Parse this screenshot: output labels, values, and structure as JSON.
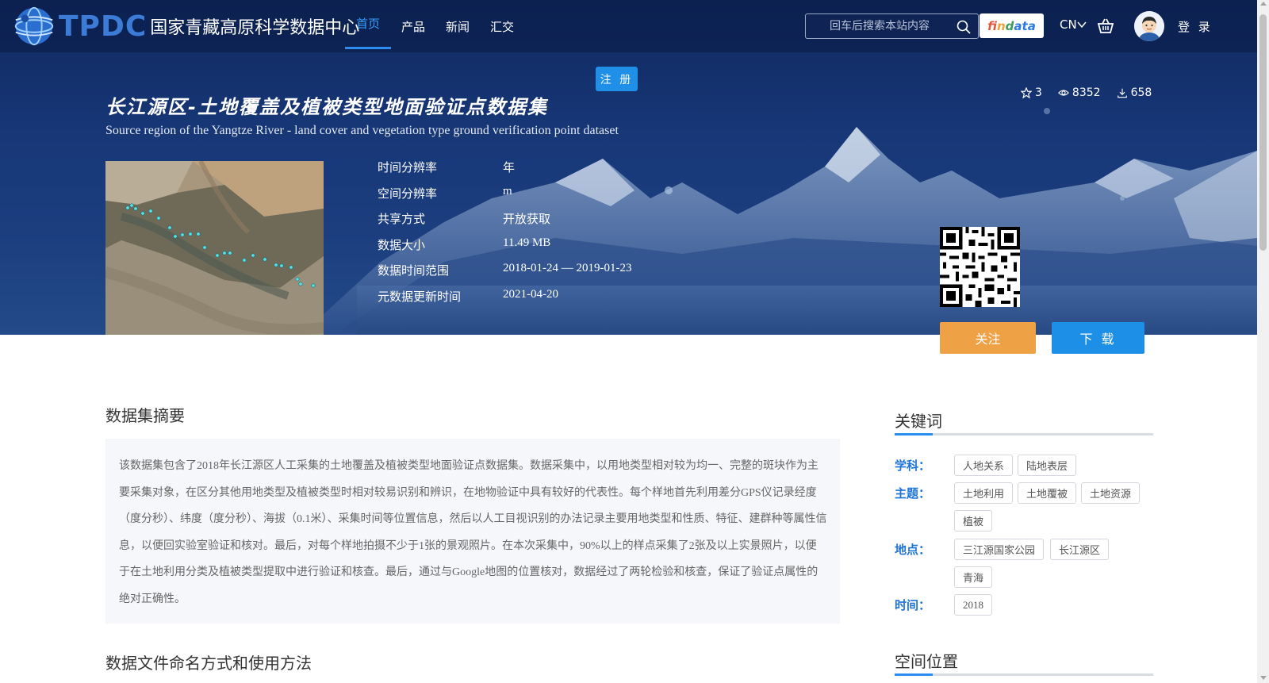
{
  "header": {
    "logo_text": "TPDC",
    "site_name": "国家青藏高原科学数据中心",
    "nav": [
      {
        "label": "首页",
        "active": true
      },
      {
        "label": "产品",
        "active": false
      },
      {
        "label": "新闻",
        "active": false
      },
      {
        "label": "汇交",
        "active": false
      }
    ],
    "search_placeholder": "回车后搜索本站内容",
    "findata": {
      "p1": "fi",
      "p2": "n",
      "p3": "d",
      "p4": "ata"
    },
    "lang": "CN",
    "login": "登 录",
    "icons": [
      "search-icon",
      "cart-icon",
      "avatar",
      "chevron-down-icon"
    ]
  },
  "dataset": {
    "register_label": "注 册",
    "title_cn": "长江源区-土地覆盖及植被类型地面验证点数据集",
    "title_en": "Source region of the Yangtze River - land cover and vegetation type ground verification point dataset",
    "stats": {
      "stars": "3",
      "views": "8352",
      "downloads": "658"
    },
    "meta": [
      {
        "key": "时间分辨率",
        "value": "年"
      },
      {
        "key": "空间分辨率",
        "value": "m"
      },
      {
        "key": "共享方式",
        "value": "开放获取"
      },
      {
        "key": "数据大小",
        "value": "11.49 MB"
      },
      {
        "key": "数据时间范围",
        "value": "2018-01-24 — 2019-01-23"
      },
      {
        "key": "元数据更新时间",
        "value": "2021-04-20"
      }
    ],
    "follow_label": "关注",
    "download_label": "下 载"
  },
  "abstract": {
    "heading": "数据集摘要",
    "text": "该数据集包含了2018年长江源区人工采集的土地覆盖及植被类型地面验证点数据集。数据采集中，以用地类型相对较为均一、完整的斑块作为主要采集对象，在区分其他用地类型及植被类型时相对较易识别和辨识，在地物验证中具有较好的代表性。每个样地首先利用差分GPS仪记录经度（度分秒）、纬度（度分秒）、海拔（0.1米）、采集时间等位置信息，然后以人工目视识别的办法记录主要用地类型和性质、特征、建群种等属性信息，以便回实验室验证和核对。最后，对每个样地拍摄不少于1张的景观照片。在本次采集中，90%以上的样点采集了2张及以上实景照片，以便于在土地利用分类及植被类型提取中进行验证和核查。最后，通过与Google地图的位置核对，数据经过了两轮检验和核查，保证了验证点属性的绝对正确性。"
  },
  "filename_heading": "数据文件命名方式和使用方法",
  "keywords": {
    "heading": "关键词",
    "groups": [
      {
        "label": "学科：",
        "tags": [
          "人地关系",
          "陆地表层"
        ]
      },
      {
        "label": "主题：",
        "tags": [
          "土地利用",
          "土地覆被",
          "土地资源",
          "植被"
        ]
      },
      {
        "label": "地点：",
        "tags": [
          "三江源国家公园",
          "长江源区",
          "青海"
        ]
      },
      {
        "label": "时间：",
        "tags": [
          "2018"
        ]
      }
    ]
  },
  "spatial_heading": "空间位置",
  "colors": {
    "accent": "#2d8cf0",
    "follow": "#eea145",
    "download": "#1d8fe6",
    "keyword_label": "#1e73d8"
  }
}
